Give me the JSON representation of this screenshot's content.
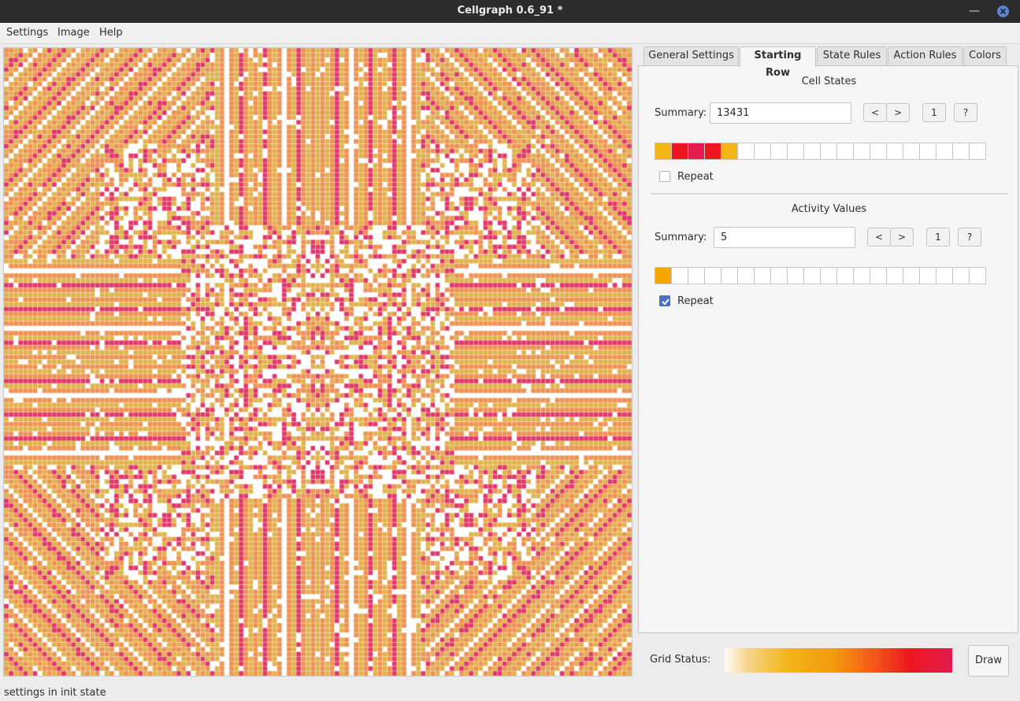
{
  "window": {
    "title": "Cellgraph 0.6_91 *"
  },
  "menu": [
    "Settings",
    "Image",
    "Help"
  ],
  "tabs": [
    "General Settings",
    "Starting Row",
    "State Rules",
    "Action Rules",
    "Colors"
  ],
  "active_tab": "Starting Row",
  "cell_states": {
    "title": "Cell States",
    "summary_label": "Summary:",
    "summary_value": "13431",
    "buttons": {
      "prev": "<",
      "next": ">",
      "one": "1",
      "help": "?"
    },
    "cells": [
      "#f2b417",
      "#ed1520",
      "#e31d50",
      "#ed1520",
      "#f2b417"
    ],
    "cell_count": 20,
    "repeat_label": "Repeat",
    "repeat_checked": false
  },
  "activity_values": {
    "title": "Activity Values",
    "summary_label": "Summary:",
    "summary_value": "5",
    "buttons": {
      "prev": "<",
      "next": ">",
      "one": "1",
      "help": "?"
    },
    "cells": [
      "#f6a800"
    ],
    "cell_count": 20,
    "repeat_label": "Repeat",
    "repeat_checked": true
  },
  "bottom": {
    "grid_status_label": "Grid Status:",
    "draw_label": "Draw"
  },
  "status_text": "settings in init state",
  "palette": {
    "white": "#ffffff",
    "yellow": "#e0b44c",
    "orange": "#ef9152",
    "red": "#e0376a"
  }
}
